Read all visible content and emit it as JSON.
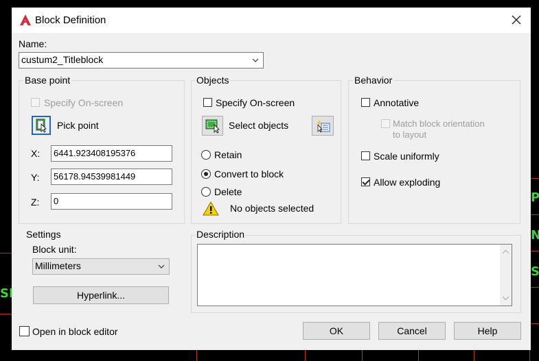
{
  "background": {
    "left_text": "SI",
    "right_texts": [
      "PT",
      "NI",
      "SS"
    ]
  },
  "dialog": {
    "title": "Block Definition",
    "app_icon": "autocad-icon",
    "close_icon": "close-icon",
    "name_label": "Name:",
    "name_value": "custum2_Titleblock"
  },
  "base_point": {
    "title": "Base point",
    "specify_onscreen": "Specify On-screen",
    "pick_point": "Pick point",
    "x_label": "X:",
    "x_value": "6441.923408195376",
    "y_label": "Y:",
    "y_value": "56178.94539981449",
    "z_label": "Z:",
    "z_value": "0"
  },
  "objects": {
    "title": "Objects",
    "specify_onscreen": "Specify On-screen",
    "select_objects": "Select objects",
    "retain": "Retain",
    "convert": "Convert to block",
    "delete": "Delete",
    "status": "No objects selected",
    "selected_option": "convert"
  },
  "behavior": {
    "title": "Behavior",
    "annotative": "Annotative",
    "match_orientation_1": "Match block orientation",
    "match_orientation_2": "to layout",
    "scale_uniformly": "Scale uniformly",
    "allow_exploding": "Allow exploding",
    "allow_exploding_checked": true
  },
  "settings": {
    "title": "Settings",
    "block_unit_label": "Block unit:",
    "block_unit_value": "Millimeters",
    "hyperlink": "Hyperlink..."
  },
  "description": {
    "title": "Description",
    "value": ""
  },
  "footer": {
    "open_in_editor": "Open in block editor",
    "ok": "OK",
    "cancel": "Cancel",
    "help": "Help"
  },
  "colors": {
    "accent_icon": "#c8323a",
    "warning": "#f5d10a",
    "cad_green": "#3fd33f"
  }
}
